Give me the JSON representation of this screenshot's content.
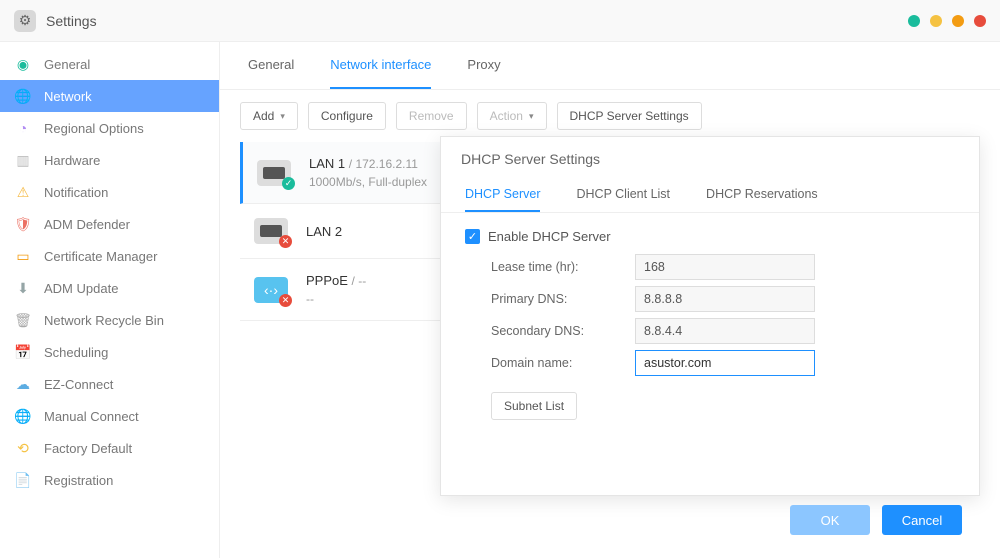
{
  "window": {
    "title": "Settings"
  },
  "sidebar": {
    "items": [
      {
        "label": "General"
      },
      {
        "label": "Network"
      },
      {
        "label": "Regional Options"
      },
      {
        "label": "Hardware"
      },
      {
        "label": "Notification"
      },
      {
        "label": "ADM Defender"
      },
      {
        "label": "Certificate Manager"
      },
      {
        "label": "ADM Update"
      },
      {
        "label": "Network Recycle Bin"
      },
      {
        "label": "Scheduling"
      },
      {
        "label": "EZ-Connect"
      },
      {
        "label": "Manual Connect"
      },
      {
        "label": "Factory Default"
      },
      {
        "label": "Registration"
      }
    ]
  },
  "tabs": {
    "general": "General",
    "network_interface": "Network interface",
    "proxy": "Proxy"
  },
  "toolbar": {
    "add": "Add",
    "configure": "Configure",
    "remove": "Remove",
    "action": "Action",
    "dhcp_settings": "DHCP Server Settings"
  },
  "interfaces": [
    {
      "name": "LAN 1",
      "ip": "172.16.2.11",
      "detail": "1000Mb/s, Full-duplex",
      "status": "ok"
    },
    {
      "name": "LAN 2",
      "ip": "",
      "detail": "",
      "status": "err"
    },
    {
      "name": "PPPoE",
      "ip": "--",
      "detail": "--",
      "status": "err"
    }
  ],
  "dhcp": {
    "title": "DHCP Server Settings",
    "tabs": {
      "server": "DHCP Server",
      "client_list": "DHCP Client List",
      "reservations": "DHCP Reservations"
    },
    "enable_label": "Enable DHCP Server",
    "enable_checked": true,
    "fields": {
      "lease_label": "Lease time (hr):",
      "lease_value": "168",
      "primary_dns_label": "Primary DNS:",
      "primary_dns_value": "8.8.8.8",
      "secondary_dns_label": "Secondary DNS:",
      "secondary_dns_value": "8.8.4.4",
      "domain_label": "Domain name:",
      "domain_value": "asustor.com"
    },
    "subnet_list": "Subnet List",
    "ok": "OK",
    "cancel": "Cancel"
  }
}
